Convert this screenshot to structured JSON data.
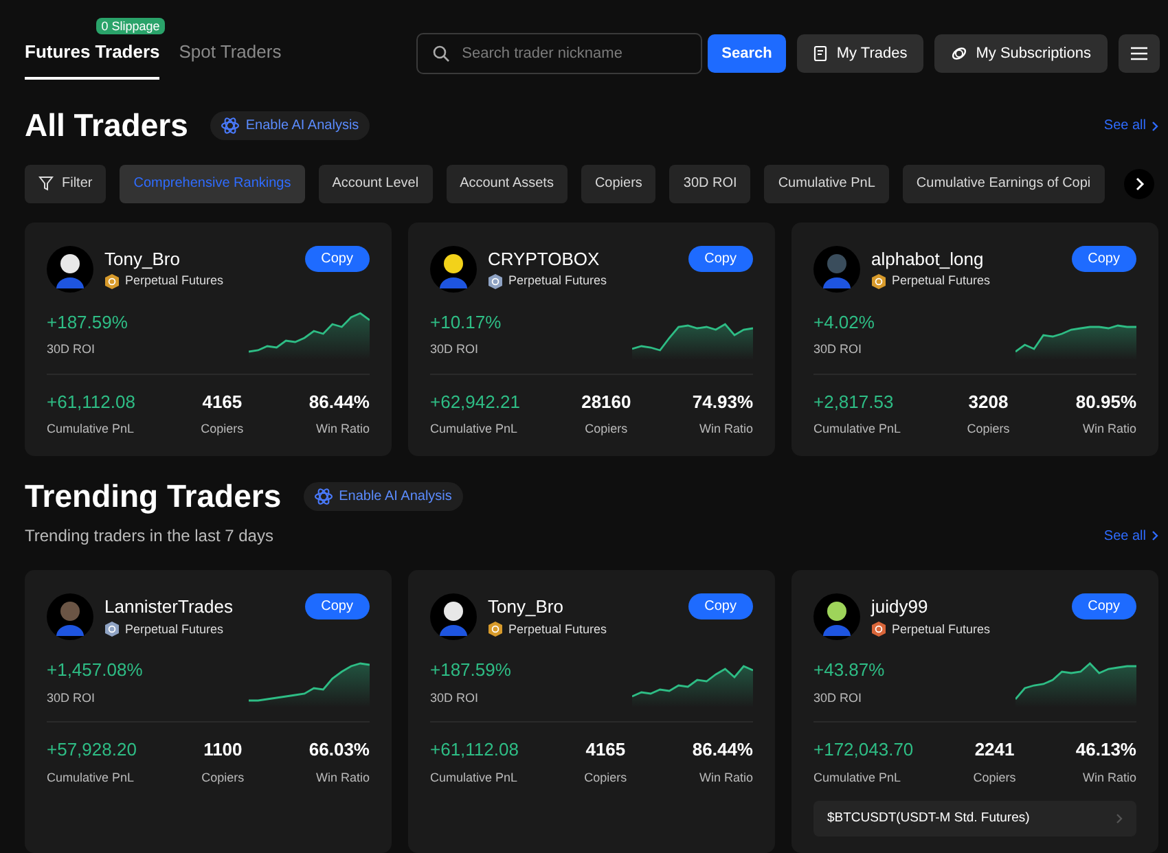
{
  "tabs": [
    {
      "label": "Futures Traders",
      "selected": true,
      "badge": "0 Slippage"
    },
    {
      "label": "Spot Traders",
      "selected": false
    }
  ],
  "search": {
    "placeholder": "Search trader nickname",
    "button": "Search"
  },
  "actions": [
    {
      "label": "My Trades",
      "kind": "trades"
    },
    {
      "label": "My Subscriptions",
      "kind": "subs"
    },
    {
      "kind": "menu"
    }
  ],
  "sections": [
    {
      "title": "All Traders",
      "ai_label": "Enable AI Analysis",
      "see_all": "See all",
      "filters": [
        {
          "label": "Filter",
          "kind": "filter",
          "selected": false
        },
        {
          "label": "Comprehensive Rankings",
          "kind": "chip",
          "selected": true
        },
        {
          "label": "Account Level",
          "kind": "chip",
          "selected": false
        },
        {
          "label": "Account Assets",
          "kind": "chip",
          "selected": false
        },
        {
          "label": "Copiers",
          "kind": "chip",
          "selected": false
        },
        {
          "label": "30D ROI",
          "kind": "chip",
          "selected": false
        },
        {
          "label": "Cumulative PnL",
          "kind": "chip",
          "selected": false
        },
        {
          "label": "Cumulative Earnings of Copi",
          "kind": "chip",
          "selected": false
        }
      ],
      "cards": [
        {
          "name": "Tony_Bro",
          "market": "Perpetual Futures",
          "color": "#d79a2b",
          "copy": "Copy",
          "roi": "+187.59%",
          "roi_label": "30D ROI",
          "pnl": "+61,112.08",
          "pnl_label": "Cumulative PnL",
          "copiers": "4165",
          "copiers_label": "Copiers",
          "win": "86.44%",
          "win_label": "Win Ratio"
        },
        {
          "name": "CRYPTOBOX",
          "market": "Perpetual Futures",
          "color": "#8fa3c4",
          "copy": "Copy",
          "roi": "+10.17%",
          "roi_label": "30D ROI",
          "pnl": "+62,942.21",
          "pnl_label": "Cumulative PnL",
          "copiers": "28160",
          "copiers_label": "Copiers",
          "win": "74.93%",
          "win_label": "Win Ratio"
        },
        {
          "name": "alphabot_long",
          "market": "Perpetual Futures",
          "color": "#d79a2b",
          "copy": "Copy",
          "roi": "+4.02%",
          "roi_label": "30D ROI",
          "pnl": "+2,817.53",
          "pnl_label": "Cumulative PnL",
          "copiers": "3208",
          "copiers_label": "Copiers",
          "win": "80.95%",
          "win_label": "Win Ratio"
        }
      ]
    },
    {
      "title": "Trending Traders",
      "ai_label": "Enable AI Analysis",
      "see_all": "See all",
      "subtitle": "Trending traders in the last 7 days",
      "cards": [
        {
          "name": "LannisterTrades",
          "market": "Perpetual Futures",
          "color": "#8fa3c4",
          "copy": "Copy",
          "roi": "+1,457.08%",
          "roi_label": "30D ROI",
          "pnl": "+57,928.20",
          "pnl_label": "Cumulative PnL",
          "copiers": "1100",
          "copiers_label": "Copiers",
          "win": "66.03%",
          "win_label": "Win Ratio"
        },
        {
          "name": "Tony_Bro",
          "market": "Perpetual Futures",
          "color": "#d79a2b",
          "copy": "Copy",
          "roi": "+187.59%",
          "roi_label": "30D ROI",
          "pnl": "+61,112.08",
          "pnl_label": "Cumulative PnL",
          "copiers": "4165",
          "copiers_label": "Copiers",
          "win": "86.44%",
          "win_label": "Win Ratio"
        },
        {
          "name": "juidy99",
          "market": "Perpetual Futures",
          "color": "#d9663a",
          "copy": "Copy",
          "roi": "+43.87%",
          "roi_label": "30D ROI",
          "pnl": "+172,043.70",
          "pnl_label": "Cumulative PnL",
          "copiers": "2241",
          "copiers_label": "Copiers",
          "win": "46.13%",
          "win_label": "Win Ratio",
          "pair": "$BTCUSDT(USDT-M Std. Futures)"
        }
      ]
    }
  ]
}
